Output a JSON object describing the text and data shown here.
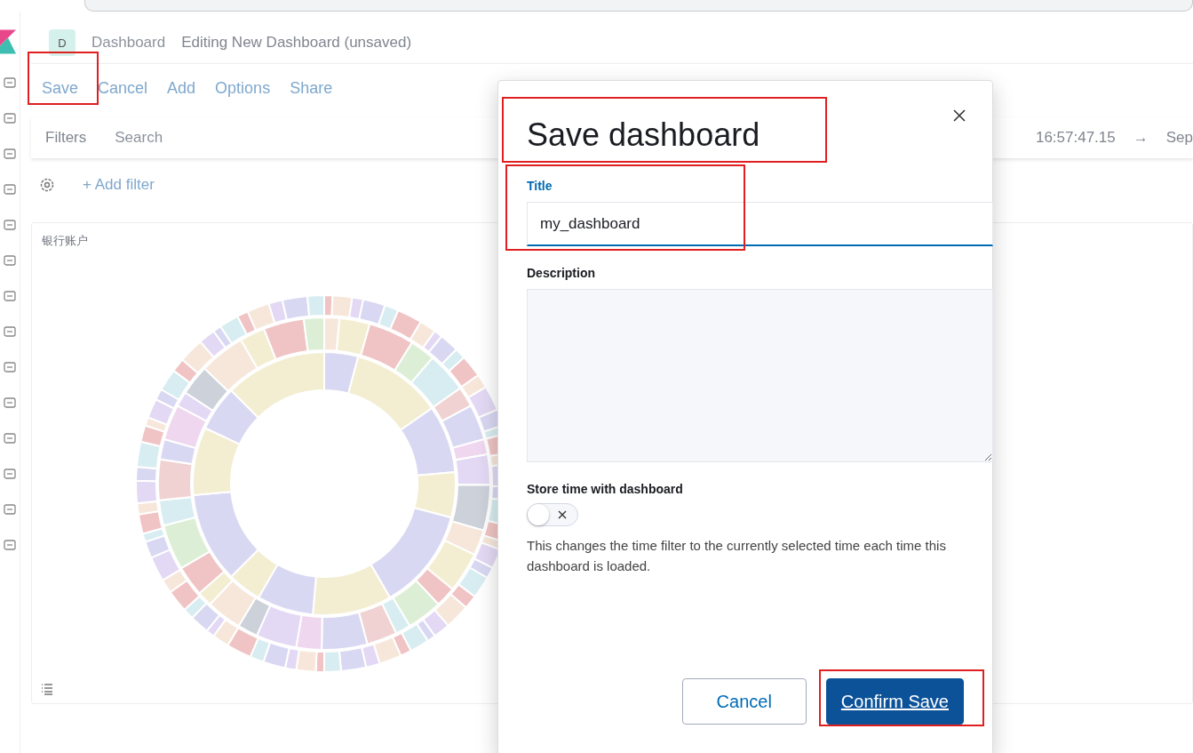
{
  "app_header": {
    "avatar": "D",
    "breadcrumbs": [
      "Dashboard",
      "Editing New Dashboard (unsaved)"
    ]
  },
  "top_menu": [
    {
      "label": "Save",
      "highlighted": true
    },
    {
      "label": "Cancel",
      "highlighted": false
    },
    {
      "label": "Add",
      "highlighted": false
    },
    {
      "label": "Options",
      "highlighted": false
    },
    {
      "label": "Share",
      "highlighted": false
    }
  ],
  "query_bar": {
    "filters_label": "Filters",
    "placeholder": "Search",
    "time_start": "16:57:47.15",
    "arrow": "→",
    "time_end": "Sep"
  },
  "add_filter": "+ Add filter",
  "panel": {
    "title": "银行账户"
  },
  "modal": {
    "title": "Save dashboard",
    "title_highlighted": true,
    "fields": [
      {
        "kind": "input",
        "label": "Title",
        "value": "my_dashboard",
        "focused": true,
        "highlighted": true
      },
      {
        "kind": "textarea",
        "label": "Description",
        "focused": false,
        "highlighted": false
      }
    ],
    "toggle": {
      "label": "Store time with dashboard",
      "on": false,
      "help": "This changes the time filter to the currently selected time each time this dashboard is loaded."
    },
    "buttons": [
      {
        "label": "Cancel",
        "kind": "secondary",
        "highlighted": false
      },
      {
        "label": "Confirm Save",
        "kind": "primary",
        "highlighted": true
      }
    ]
  }
}
